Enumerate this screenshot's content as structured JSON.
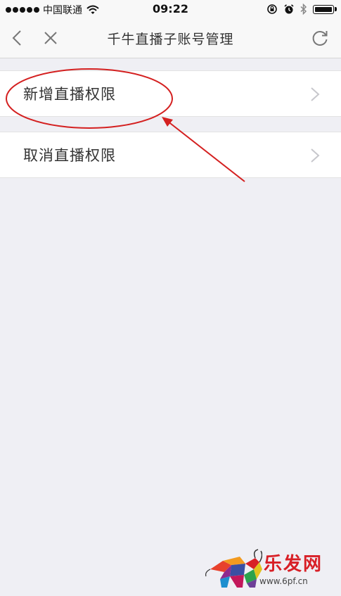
{
  "status_bar": {
    "carrier": "中国联通",
    "time": "09:22",
    "signal_bars": 5,
    "battery_level": 1.0
  },
  "nav": {
    "title": "千牛直播子账号管理",
    "back_icon": "chevron-left-icon",
    "close_icon": "close-icon",
    "refresh_icon": "refresh-icon"
  },
  "menu": {
    "items": [
      {
        "label": "新增直播权限"
      },
      {
        "label": "取消直播权限"
      }
    ]
  },
  "annotation": {
    "color": "#d42020"
  },
  "watermark": {
    "title": "乐发网",
    "url": "www.6pf.cn"
  }
}
